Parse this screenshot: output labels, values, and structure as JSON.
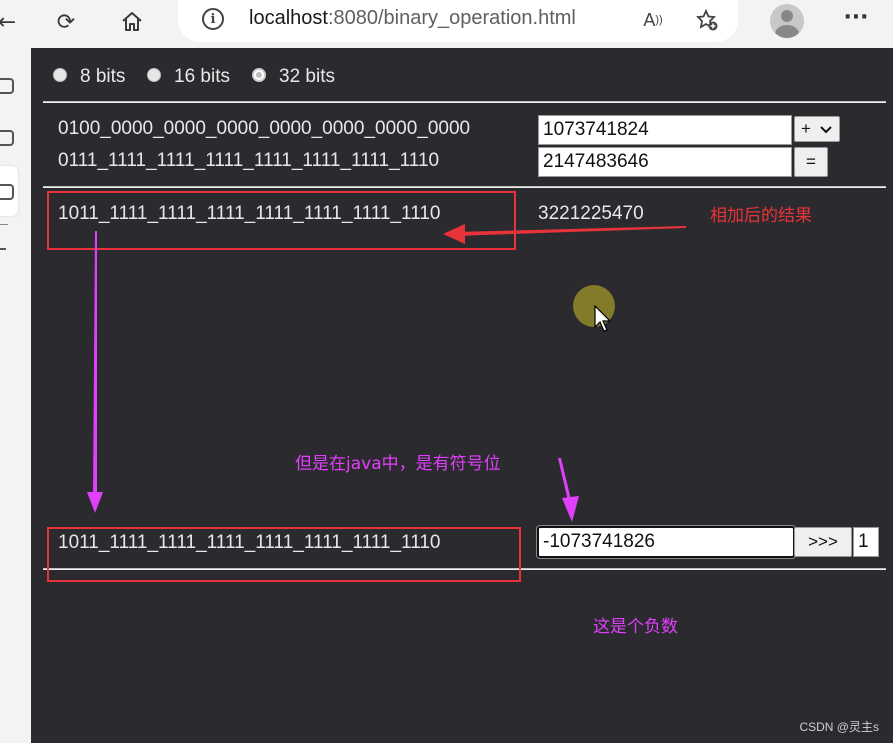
{
  "browser": {
    "url_host": "localhost",
    "url_rest": ":8080/binary_operation.html"
  },
  "bit_options": [
    "8 bits",
    "16 bits",
    "32 bits"
  ],
  "selected_bits": "32 bits",
  "operation": {
    "a_binary": "0100_0000_0000_0000_0000_0000_0000_0000",
    "a_value": "1073741824",
    "b_binary": "0111_1111_1111_1111_1111_1111_1111_1110",
    "b_value": "2147483646",
    "operator": "+",
    "equals_label": "=",
    "result_binary": "1011_1111_1111_1111_1111_1111_1111_1110",
    "result_value": "3221225470"
  },
  "shift": {
    "binary": "1011_1111_1111_1111_1111_1111_1111_1110",
    "value": "-1073741826",
    "button_label": ">>>",
    "amount": "1"
  },
  "annotations": {
    "sum_result": "相加后的结果",
    "signed_in_java": "但是在java中，是有符号位",
    "negative": "这是个负数",
    "colors": {
      "red": "#e8333a",
      "magenta": "#e040fb"
    }
  },
  "watermark": "CSDN @灵主s"
}
